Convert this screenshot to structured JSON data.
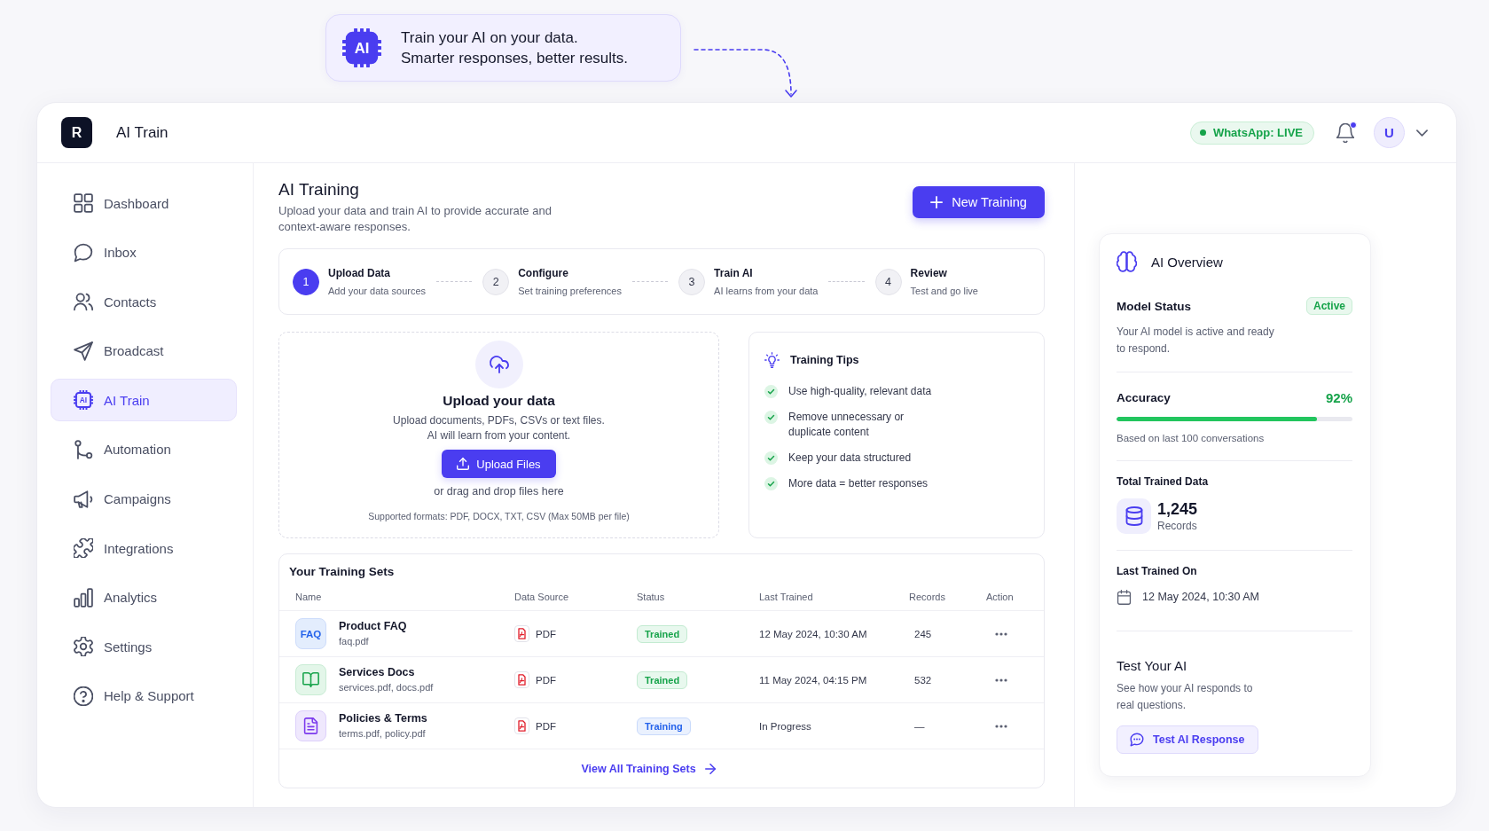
{
  "callout": {
    "icon_text": "AI",
    "lines": [
      "Train your AI on your data.",
      "Smarter responses, better results."
    ]
  },
  "header": {
    "logo": "R",
    "title": "AI Train",
    "connection": "WhatsApp: LIVE",
    "unread": true,
    "avatar": "U"
  },
  "sidebar": {
    "items": [
      {
        "label": "Dashboard",
        "selected": false
      },
      {
        "label": "Inbox",
        "selected": false
      },
      {
        "label": "Contacts",
        "selected": false
      },
      {
        "label": "Broadcast",
        "selected": false
      },
      {
        "label": "AI Train",
        "selected": true,
        "icon_text": "AI"
      },
      {
        "label": "Automation",
        "selected": false
      },
      {
        "label": "Campaigns",
        "selected": false
      },
      {
        "label": "Integrations",
        "selected": false
      },
      {
        "label": "Analytics",
        "selected": false
      },
      {
        "label": "Settings",
        "selected": false
      },
      {
        "label": "Help & Support",
        "selected": false
      }
    ]
  },
  "page": {
    "title": "AI Training",
    "subtitle": "Upload your data and train AI to provide accurate and context-aware responses.",
    "new_button": "New Training"
  },
  "steps": [
    {
      "number": "1",
      "title": "Upload Data",
      "subtitle": "Add your data sources",
      "current": true
    },
    {
      "number": "2",
      "title": "Configure",
      "subtitle": "Set training preferences",
      "current": false
    },
    {
      "number": "3",
      "title": "Train AI",
      "subtitle": "AI learns from your data",
      "current": false
    },
    {
      "number": "4",
      "title": "Review",
      "subtitle": "Test and go live",
      "current": false
    }
  ],
  "upload": {
    "title": "Upload your data",
    "description": [
      "Upload documents, PDFs, CSVs or text files.",
      "AI will learn from your content."
    ],
    "button": "Upload Files",
    "hint": "or drag and drop files here",
    "formats": "Supported formats: PDF, DOCX, TXT, CSV (Max 50MB per file)"
  },
  "tips": {
    "title": "Training Tips",
    "items": [
      "Use high-quality, relevant data",
      "Remove unnecessary or duplicate content",
      "Keep your data structured",
      "More data = better responses"
    ]
  },
  "training_sets": {
    "title": "Your Training Sets",
    "columns": [
      "Name",
      "Data Source",
      "Status",
      "Last Trained",
      "Records",
      "Action"
    ],
    "rows": [
      {
        "kind": "text",
        "icon_text": "FAQ",
        "name": "Product FAQ",
        "files": "faq.pdf",
        "source": "PDF",
        "status": {
          "label": "Trained",
          "kind": "done"
        },
        "last_trained": "12 May 2024, 10:30 AM",
        "records": "245"
      },
      {
        "kind": "book",
        "name": "Services Docs",
        "files": "services.pdf, docs.pdf",
        "source": "PDF",
        "status": {
          "label": "Trained",
          "kind": "done"
        },
        "last_trained": "11 May 2024, 04:15 PM",
        "records": "532"
      },
      {
        "kind": "document",
        "name": "Policies & Terms",
        "files": "terms.pdf, policy.pdf",
        "source": "PDF",
        "status": {
          "label": "Training",
          "kind": "in_progress"
        },
        "last_trained": "In Progress",
        "records": "—"
      }
    ],
    "footer_link": "View All Training Sets"
  },
  "overview": {
    "title": "AI Overview",
    "model_status": {
      "label": "Model Status",
      "badge": "Active",
      "description": "Your AI model is active and ready to respond."
    },
    "accuracy": {
      "label": "Accuracy",
      "value": "92%",
      "level": 0.85,
      "note": "Based on last 100 conversations"
    },
    "total_data": {
      "label": "Total Trained Data",
      "value": "1,245",
      "unit": "Records"
    },
    "last_trained": {
      "label": "Last Trained On",
      "value": "12 May 2024, 10:30 AM"
    },
    "test": {
      "title": "Test Your AI",
      "description": "See how your AI responds to real questions.",
      "button": "Test AI Response"
    }
  }
}
